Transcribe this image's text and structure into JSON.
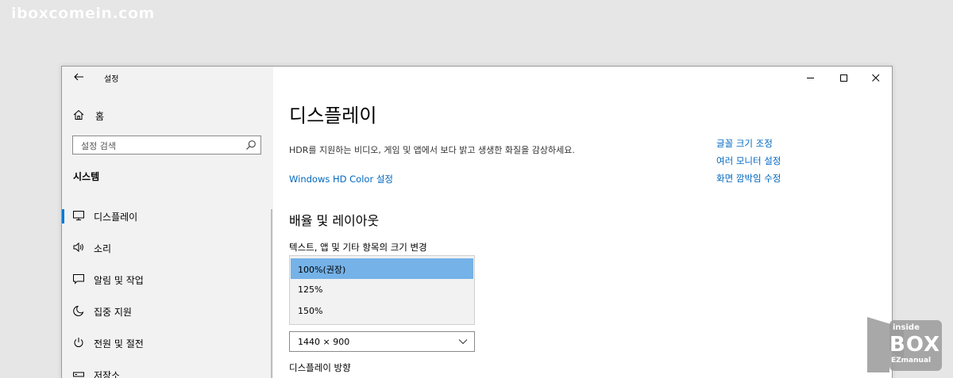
{
  "watermark": "iboxcomein.com",
  "window": {
    "app_title": "설정",
    "home_label": "홈",
    "search_placeholder": "설정 검색",
    "section_title": "시스템"
  },
  "sidebar": {
    "items": [
      {
        "label": "디스플레이",
        "icon": "monitor-icon",
        "active": true
      },
      {
        "label": "소리",
        "icon": "speaker-icon"
      },
      {
        "label": "알림 및 작업",
        "icon": "notification-icon"
      },
      {
        "label": "집중 지원",
        "icon": "moon-icon"
      },
      {
        "label": "전원 및 절전",
        "icon": "power-icon"
      },
      {
        "label": "저장소",
        "icon": "storage-icon"
      }
    ]
  },
  "main": {
    "title": "디스플레이",
    "hdr_description": "HDR를 지원하는 비디오, 게임 및 앱에서 보다 밝고 생생한 화질을 감상하세요.",
    "hdr_link": "Windows HD Color 설정",
    "related_links": [
      "글꼴 크기 조정",
      "여러 모니터 설정",
      "화면 깜박임 수정"
    ],
    "layout_heading": "배율 및 레이아웃",
    "scale_label": "텍스트, 앱 및 기타 항목의 크기 변경",
    "scale_options": [
      "100%(권장)",
      "125%",
      "150%"
    ],
    "scale_selected": "100%(권장)",
    "resolution_value": "1440 × 900",
    "orientation_label": "디스플레이 방향"
  },
  "logo": {
    "line1": "inside",
    "line2": "BOX",
    "line3": "EZmanual"
  },
  "colors": {
    "accent": "#0078d7",
    "link": "#0067c0",
    "selected_option": "#75b2e8",
    "sidebar_bg": "#f2f2f2"
  }
}
